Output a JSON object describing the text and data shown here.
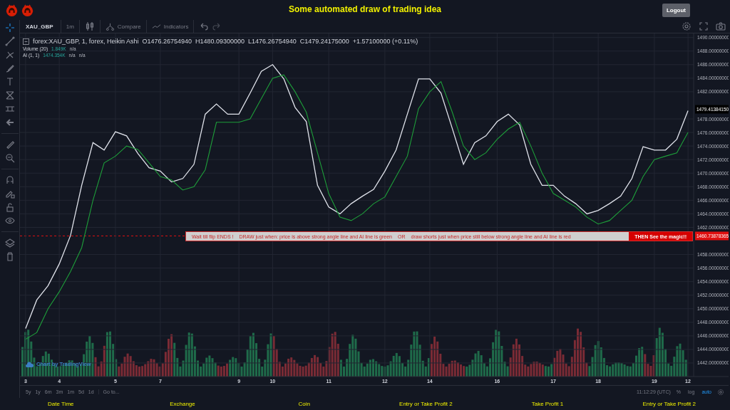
{
  "header": {
    "title": "Some automated draw of trading idea",
    "logout": "Logout"
  },
  "toolbar": {
    "symbol": "XAU_GBP",
    "interval": "1m",
    "compare": "Compare",
    "indicators": "Indicators"
  },
  "legend": {
    "title": "forex:XAU_GBP, 1, forex, Heikin Ashi",
    "ohlc": [
      {
        "label": "O",
        "value": "1476.26754940"
      },
      {
        "label": "H",
        "value": "1480.09300000"
      },
      {
        "label": "L",
        "value": "1476.26754940"
      },
      {
        "label": "C",
        "value": "1479.24175000"
      }
    ],
    "change": "+1.57100000 (+0.11%)"
  },
  "studies": [
    {
      "name": "Volume (20)",
      "values": [
        "1.849K",
        "n/a"
      ]
    },
    {
      "name": "AI (1, 1)",
      "values": [
        "1474.354K",
        "n/a",
        "n/a"
      ]
    }
  ],
  "drawing_note": {
    "texts": [
      "Wait till flip ENDS  !",
      "DRAW just when:  price is above strong angle line and AI line is green",
      "OR",
      "draw shorts just when price still below strong angle line and AI line is red"
    ],
    "callout": "THEN See the magic!!"
  },
  "chart_data": {
    "type": "line",
    "categories": [
      "3",
      null,
      null,
      "4",
      null,
      null,
      null,
      null,
      "5",
      null,
      null,
      null,
      "7",
      null,
      null,
      null,
      null,
      null,
      null,
      "9",
      null,
      null,
      "10",
      null,
      null,
      null,
      null,
      "11",
      null,
      null,
      null,
      null,
      "12",
      null,
      null,
      null,
      "14",
      null,
      null,
      null,
      null,
      null,
      "16",
      null,
      null,
      null,
      null,
      "17",
      null,
      null,
      null,
      "18",
      null,
      null,
      null,
      null,
      "19",
      null,
      null,
      "12"
    ],
    "series": [
      {
        "color": "#e0e3eb",
        "values": [
          1447.1,
          1451.3,
          1453.4,
          1456.6,
          1460.8,
          1468.2,
          1474.5,
          1473.4,
          1476.1,
          1475.5,
          1472.9,
          1470.8,
          1470.3,
          1468.7,
          1469.2,
          1471.3,
          1478.7,
          1480.2,
          1478.7,
          1478.7,
          1481.8,
          1485.0,
          1486.0,
          1483.9,
          1479.7,
          1477.6,
          1468.2,
          1465.0,
          1464.0,
          1465.5,
          1466.6,
          1467.6,
          1470.3,
          1473.4,
          1478.7,
          1483.9,
          1483.9,
          1481.8,
          1476.6,
          1471.3,
          1474.5,
          1475.5,
          1477.6,
          1478.7,
          1477.1,
          1471.3,
          1468.2,
          1468.2,
          1466.6,
          1465.5,
          1464.0,
          1464.5,
          1465.5,
          1466.6,
          1469.2,
          1473.9,
          1473.4,
          1473.4,
          1475.0,
          1479.2
        ]
      },
      {
        "color": "#1e9e3a",
        "values": [
          1445.5,
          1446.5,
          1450.0,
          1452.5,
          1455.5,
          1459.0,
          1466.0,
          1471.5,
          1472.5,
          1474.0,
          1473.5,
          1471.5,
          1469.5,
          1469.0,
          1467.5,
          1468.0,
          1470.5,
          1477.5,
          1477.5,
          1477.5,
          1478.0,
          1481.0,
          1484.0,
          1484.5,
          1482.0,
          1479.0,
          1473.0,
          1467.0,
          1463.5,
          1463.0,
          1464.0,
          1465.5,
          1466.5,
          1469.5,
          1472.5,
          1479.5,
          1482.0,
          1483.5,
          1479.0,
          1474.0,
          1472.0,
          1473.0,
          1475.0,
          1476.5,
          1477.5,
          1474.0,
          1470.0,
          1467.0,
          1466.0,
          1465.0,
          1463.5,
          1462.5,
          1463.0,
          1464.5,
          1466.0,
          1469.5,
          1472.0,
          1472.5,
          1473.0,
          1476.0
        ]
      }
    ],
    "ylim": [
      1440,
      1490.6
    ],
    "grid": true,
    "yticks": [
      {
        "value": 1442,
        "label": "1442.00000000"
      },
      {
        "value": 1444,
        "label": "1444.00000000"
      },
      {
        "value": 1446,
        "label": "1446.00000000"
      },
      {
        "value": 1448,
        "label": "1448.00000000"
      },
      {
        "value": 1450,
        "label": "1450.00000000"
      },
      {
        "value": 1452,
        "label": "1452.00000000"
      },
      {
        "value": 1454,
        "label": "1454.00000000"
      },
      {
        "value": 1456,
        "label": "1456.00000000"
      },
      {
        "value": 1458,
        "label": "1458.00000000"
      },
      {
        "value": 1462,
        "label": "1462.00000000"
      },
      {
        "value": 1464,
        "label": "1464.00000000"
      },
      {
        "value": 1466,
        "label": "1466.00000000"
      },
      {
        "value": 1468,
        "label": "1468.00000000"
      },
      {
        "value": 1470,
        "label": "1470.00000000"
      },
      {
        "value": 1472,
        "label": "1472.00000000"
      },
      {
        "value": 1474,
        "label": "1474.00000000"
      },
      {
        "value": 1476,
        "label": "1476.00000000"
      },
      {
        "value": 1478,
        "label": "1478.00000000"
      },
      {
        "value": 1482,
        "label": "1482.00000000"
      },
      {
        "value": 1484,
        "label": "1484.00000000"
      },
      {
        "value": 1486,
        "label": "1486.00000000"
      },
      {
        "value": 1488,
        "label": "1488.00000000"
      },
      {
        "value": 1490,
        "label": "1490.00000000"
      }
    ]
  },
  "price_axis": {
    "last_price": "1479.41384150",
    "drawing_price": "1460.73878365"
  },
  "attribution": "Chart by TradingView",
  "bottom_bar": {
    "ranges": [
      "5y",
      "1y",
      "6m",
      "3m",
      "1m",
      "5d",
      "1d"
    ],
    "goto": "Go to...",
    "time": "11:12:29 (UTC)",
    "scale_options": [
      {
        "label": "%",
        "selected": false
      },
      {
        "label": "log",
        "selected": false
      },
      {
        "label": "auto",
        "selected": true
      }
    ]
  },
  "footer": [
    "Date Time",
    "Exchange",
    "Coin",
    "Entry or Take Profit 2",
    "Take Profit 1",
    "Entry or Take Profit 2"
  ]
}
